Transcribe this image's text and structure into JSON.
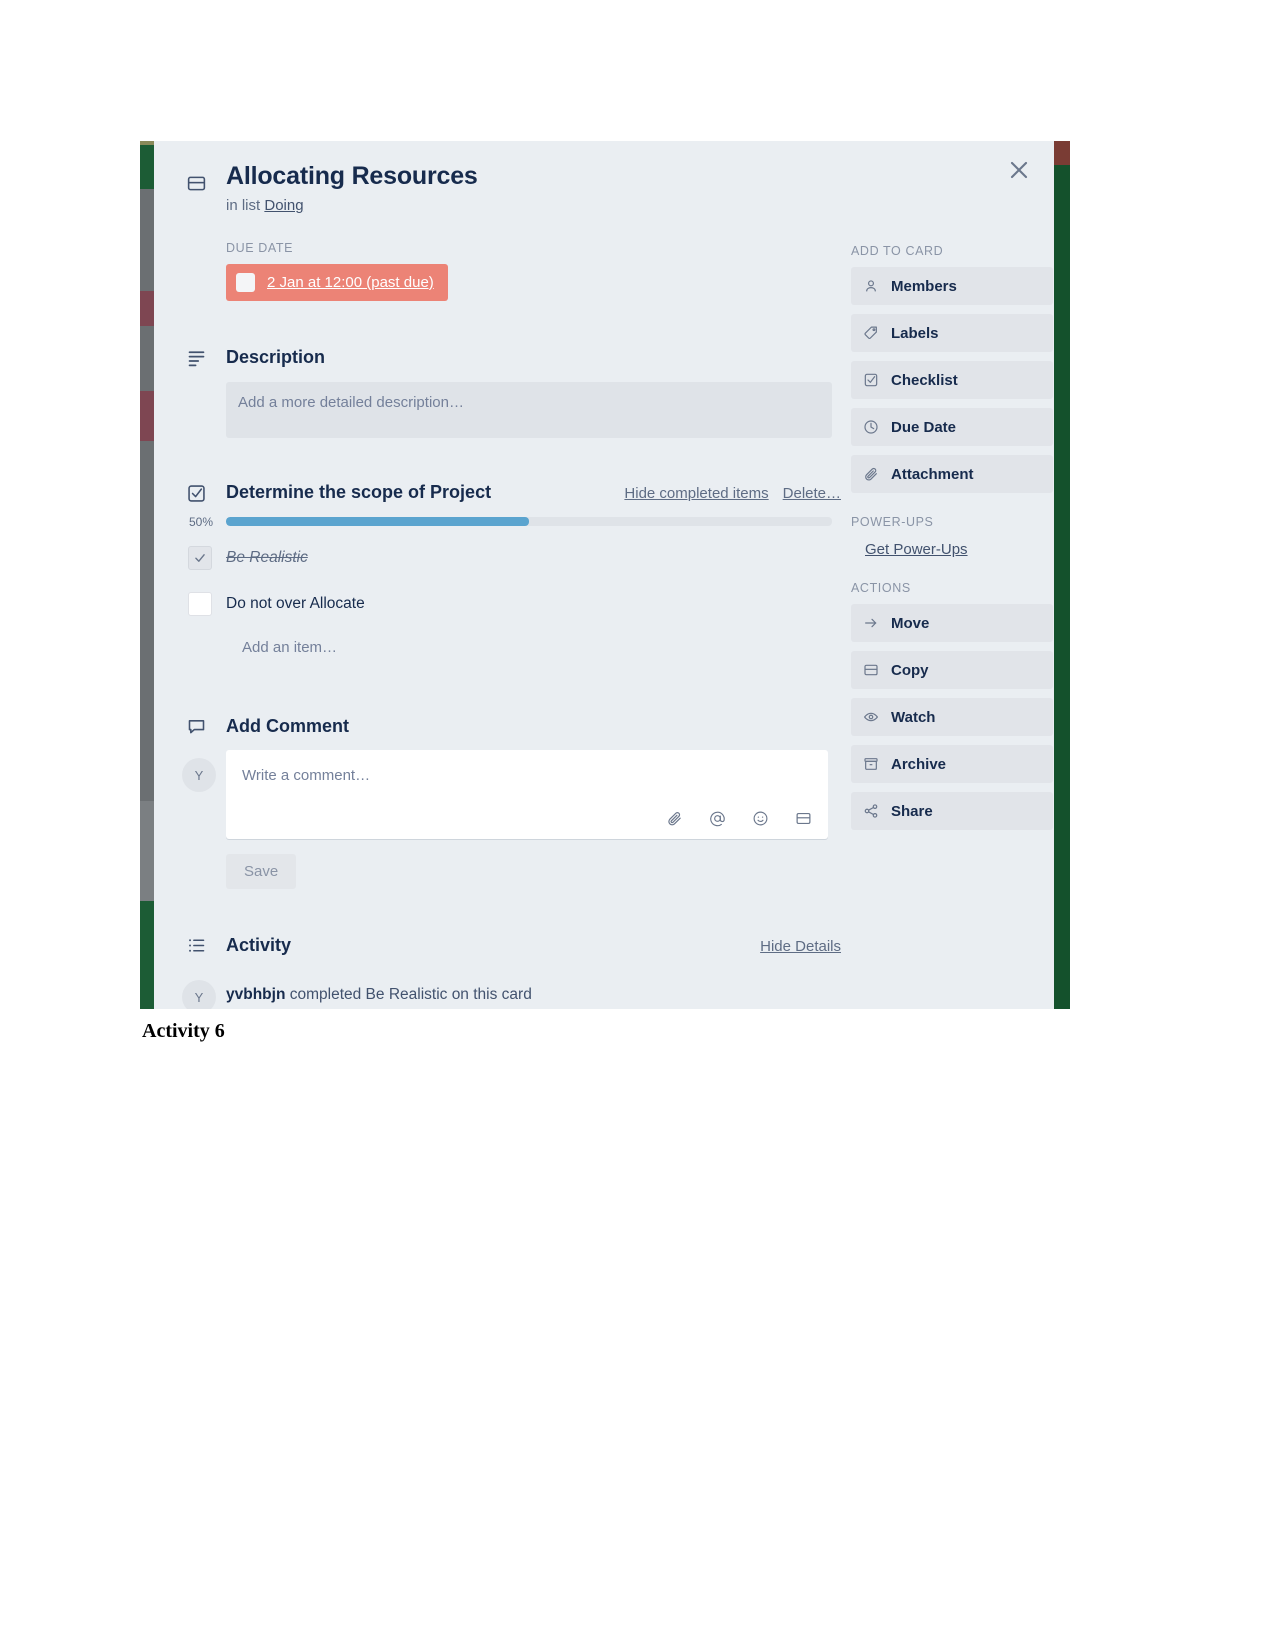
{
  "document": {
    "caption": "Activity 6"
  },
  "card": {
    "title": "Allocating Resources",
    "in_list_prefix": "in list",
    "list_name": "Doing",
    "close_label": "×",
    "icons": {
      "card": "card-icon",
      "close": "close-icon"
    }
  },
  "due_date": {
    "label": "DUE DATE",
    "value": "2 Jan at 12:00 (past due)",
    "state": "past-due",
    "badge_color": "#ec8376",
    "checkbox_checked": false
  },
  "description": {
    "label": "Description",
    "placeholder": "Add a more detailed description…",
    "value": ""
  },
  "checklist": {
    "title": "Determine the scope of Project",
    "hide_completed_label": "Hide completed items",
    "delete_label": "Delete…",
    "progress_percent_label": "50%",
    "progress_percent": 50,
    "progress_color": "#5ba4cf",
    "add_item_placeholder": "Add an item…",
    "items": [
      {
        "text": "Be Realistic",
        "checked": true
      },
      {
        "text": "Do not over Allocate",
        "checked": false
      }
    ]
  },
  "comment": {
    "heading": "Add Comment",
    "avatar_initial": "Y",
    "placeholder": "Write a comment…",
    "value": "",
    "save_label": "Save",
    "tools": [
      {
        "name": "attachment-icon",
        "glyph": "attachment"
      },
      {
        "name": "mention-icon",
        "glyph": "at"
      },
      {
        "name": "emoji-icon",
        "glyph": "emoji"
      },
      {
        "name": "card-icon",
        "glyph": "card"
      }
    ]
  },
  "activity": {
    "heading": "Activity",
    "hide_details_label": "Hide Details",
    "entries": [
      {
        "avatar_initial": "Y",
        "user": "yvbhbjn",
        "text": " completed Be Realistic on this card"
      }
    ]
  },
  "sidebar": {
    "add_to_card_label": "ADD TO CARD",
    "add_to_card_items": [
      {
        "label": "Members",
        "icon": "member-icon"
      },
      {
        "label": "Labels",
        "icon": "label-icon"
      },
      {
        "label": "Checklist",
        "icon": "checklist-icon"
      },
      {
        "label": "Due Date",
        "icon": "clock-icon"
      },
      {
        "label": "Attachment",
        "icon": "attachment-icon"
      }
    ],
    "power_ups_label": "POWER-UPS",
    "power_ups_link": "Get Power-Ups",
    "actions_label": "ACTIONS",
    "action_items": [
      {
        "label": "Move",
        "icon": "arrow-right-icon"
      },
      {
        "label": "Copy",
        "icon": "card-icon"
      },
      {
        "label": "Watch",
        "icon": "eye-icon"
      },
      {
        "label": "Archive",
        "icon": "archive-icon"
      },
      {
        "label": "Share",
        "icon": "share-icon"
      }
    ]
  }
}
